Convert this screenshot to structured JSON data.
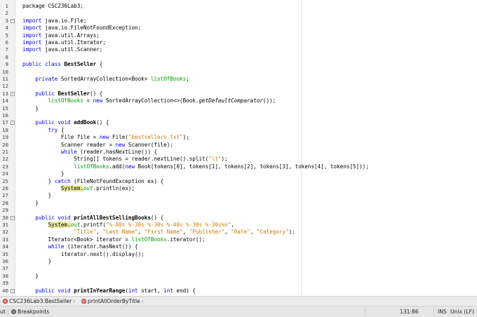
{
  "editor": {
    "lines": [
      {
        "n": "1",
        "segments": [
          {
            "t": "package CSC236Lab3;"
          }
        ]
      },
      {
        "n": "2",
        "segments": []
      },
      {
        "n": "3",
        "fold": "minus",
        "segments": [
          {
            "t": "import",
            "c": "kw"
          },
          {
            "t": " java.io.File;"
          }
        ]
      },
      {
        "n": "4",
        "segments": [
          {
            "t": "import",
            "c": "kw"
          },
          {
            "t": " java.io.FileNotFoundException;"
          }
        ]
      },
      {
        "n": "5",
        "segments": [
          {
            "t": "import",
            "c": "kw"
          },
          {
            "t": " java.util.Arrays;"
          }
        ]
      },
      {
        "n": "6",
        "segments": [
          {
            "t": "import",
            "c": "kw"
          },
          {
            "t": " java.util.Iterator;"
          }
        ]
      },
      {
        "n": "7",
        "segments": [
          {
            "t": "import",
            "c": "kw"
          },
          {
            "t": " java.util.Scanner;"
          }
        ]
      },
      {
        "n": "8",
        "segments": []
      },
      {
        "n": "9",
        "segments": [
          {
            "t": "public class",
            "c": "kw"
          },
          {
            "t": " "
          },
          {
            "t": "BestSeller",
            "c": "b"
          },
          {
            "t": " {"
          }
        ]
      },
      {
        "n": "10",
        "segments": []
      },
      {
        "n": "11",
        "segments": [
          {
            "t": "    "
          },
          {
            "t": "private",
            "c": "kw"
          },
          {
            "t": " SortedArrayCollection<Book> "
          },
          {
            "t": "listOfBooks",
            "c": "fld"
          },
          {
            "t": ";"
          }
        ]
      },
      {
        "n": "12",
        "segments": []
      },
      {
        "n": "13",
        "fold": "minus",
        "segments": [
          {
            "t": "    "
          },
          {
            "t": "public",
            "c": "kw"
          },
          {
            "t": " "
          },
          {
            "t": "BestSeller",
            "c": "b"
          },
          {
            "t": "() {"
          }
        ]
      },
      {
        "n": "14",
        "segments": [
          {
            "t": "        "
          },
          {
            "t": "listOfBooks",
            "c": "fld"
          },
          {
            "t": " = "
          },
          {
            "t": "new",
            "c": "kw"
          },
          {
            "t": " SortedArrayCollection<>(Book."
          },
          {
            "t": "getDefaultComparator",
            "c": "ita"
          },
          {
            "t": "());"
          }
        ]
      },
      {
        "n": "15",
        "segments": [
          {
            "t": "    }"
          }
        ]
      },
      {
        "n": "16",
        "segments": []
      },
      {
        "n": "17",
        "fold": "minus",
        "segments": [
          {
            "t": "    "
          },
          {
            "t": "public void",
            "c": "kw"
          },
          {
            "t": " "
          },
          {
            "t": "addBook",
            "c": "b"
          },
          {
            "t": "() {"
          }
        ]
      },
      {
        "n": "18",
        "segments": [
          {
            "t": "        "
          },
          {
            "t": "try",
            "c": "kw"
          },
          {
            "t": " {"
          }
        ]
      },
      {
        "n": "19",
        "segments": [
          {
            "t": "            File file = "
          },
          {
            "t": "new",
            "c": "kw"
          },
          {
            "t": " File("
          },
          {
            "t": "\"bestsellers.txt\"",
            "c": "str"
          },
          {
            "t": ");"
          }
        ]
      },
      {
        "n": "20",
        "segments": [
          {
            "t": "            Scanner reader = "
          },
          {
            "t": "new",
            "c": "kw"
          },
          {
            "t": " Scanner(file);"
          }
        ]
      },
      {
        "n": "21",
        "segments": [
          {
            "t": "            "
          },
          {
            "t": "while",
            "c": "kw"
          },
          {
            "t": " (reader.hasNextLine()) {"
          }
        ]
      },
      {
        "n": "22",
        "segments": [
          {
            "t": "                String[] tokens = reader.nextLine().split("
          },
          {
            "t": "\"\\t\"",
            "c": "str"
          },
          {
            "t": ");"
          }
        ]
      },
      {
        "n": "23",
        "segments": [
          {
            "t": "                "
          },
          {
            "t": "listOfBooks",
            "c": "fld"
          },
          {
            "t": ".add("
          },
          {
            "t": "new",
            "c": "kw"
          },
          {
            "t": " Book(tokens[0], tokens[1], tokens[2], tokens[3], tokens[4], tokens[5]));"
          }
        ]
      },
      {
        "n": "24",
        "segments": [
          {
            "t": "            }"
          }
        ]
      },
      {
        "n": "25",
        "segments": [
          {
            "t": "        } "
          },
          {
            "t": "catch",
            "c": "kw"
          },
          {
            "t": " (FileNotFoundException ex) {"
          }
        ]
      },
      {
        "n": "26",
        "segments": [
          {
            "t": "            "
          },
          {
            "t": "System.",
            "c": "hl"
          },
          {
            "t": "out",
            "c": "fld it"
          },
          {
            "t": ".println(ex);"
          }
        ]
      },
      {
        "n": "27",
        "segments": [
          {
            "t": "        }"
          }
        ]
      },
      {
        "n": "28",
        "segments": [
          {
            "t": "    }"
          }
        ]
      },
      {
        "n": "29",
        "segments": []
      },
      {
        "n": "30",
        "fold": "minus",
        "segments": [
          {
            "t": "    "
          },
          {
            "t": "public void",
            "c": "kw"
          },
          {
            "t": " "
          },
          {
            "t": "printAllBestSellingBooks",
            "c": "b"
          },
          {
            "t": "() {"
          }
        ]
      },
      {
        "n": "31",
        "segments": [
          {
            "t": "        "
          },
          {
            "t": "System.",
            "c": "hl"
          },
          {
            "t": "out",
            "c": "fld it"
          },
          {
            "t": ".printf("
          },
          {
            "t": "\"%-80s %-30s %-30s %-40s %-30s %-30s%n\"",
            "c": "str"
          },
          {
            "t": ","
          }
        ]
      },
      {
        "n": "32",
        "segments": [
          {
            "t": "                "
          },
          {
            "t": "\"Title\"",
            "c": "str"
          },
          {
            "t": ", "
          },
          {
            "t": "\"Last Name\"",
            "c": "str"
          },
          {
            "t": ", "
          },
          {
            "t": "\"First Name\"",
            "c": "str"
          },
          {
            "t": ", "
          },
          {
            "t": "\"Publisher\"",
            "c": "str"
          },
          {
            "t": ", "
          },
          {
            "t": "\"Date\"",
            "c": "str"
          },
          {
            "t": ", "
          },
          {
            "t": "\"Category\"",
            "c": "str"
          },
          {
            "t": ");"
          }
        ]
      },
      {
        "n": "33",
        "segments": [
          {
            "t": "        Iterator<Book> iterator = "
          },
          {
            "t": "listOfBooks",
            "c": "fld"
          },
          {
            "t": ".iterator();"
          }
        ]
      },
      {
        "n": "34",
        "segments": [
          {
            "t": "        "
          },
          {
            "t": "while",
            "c": "kw"
          },
          {
            "t": " (iterator.hasNext()) {"
          }
        ]
      },
      {
        "n": "35",
        "segments": [
          {
            "t": "            iterator.next().display();"
          }
        ]
      },
      {
        "n": "36",
        "segments": [
          {
            "t": "        }"
          }
        ]
      },
      {
        "n": "37",
        "segments": []
      },
      {
        "n": "38",
        "segments": [
          {
            "t": "    }"
          }
        ]
      },
      {
        "n": "39",
        "segments": []
      },
      {
        "n": "40",
        "fold": "minus",
        "segments": [
          {
            "t": "    "
          },
          {
            "t": "public void",
            "c": "kw"
          },
          {
            "t": " "
          },
          {
            "t": "printInYearRange",
            "c": "b"
          },
          {
            "t": "("
          },
          {
            "t": "int",
            "c": "kw"
          },
          {
            "t": " start, "
          },
          {
            "t": "int",
            "c": "kw"
          },
          {
            "t": " end) {"
          }
        ]
      }
    ]
  },
  "breadcrumb": {
    "class_label": "CSC236Lab3.BestSeller",
    "method_label": "printAllOrderByTitle",
    "class_icon": "class-icon",
    "method_icon": "method-icon"
  },
  "statusbar": {
    "left_fragment": "ut",
    "breakpoints_label": "Breakpoints",
    "position": "131:86",
    "insert_mode": "INS",
    "line_ending": "Unix (LF)"
  },
  "colors": {
    "keyword": "#0000e6",
    "string": "#ce7b00",
    "field": "#009900",
    "highlight": "#ebeb9e"
  }
}
